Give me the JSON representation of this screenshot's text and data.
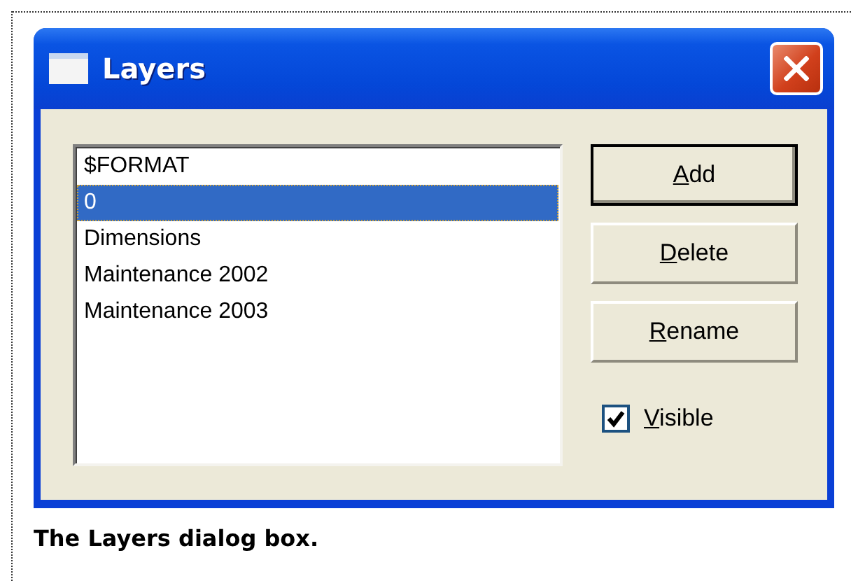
{
  "window": {
    "title": "Layers"
  },
  "list": {
    "items": [
      {
        "label": "$FORMAT",
        "selected": false
      },
      {
        "label": "0",
        "selected": true
      },
      {
        "label": "Dimensions",
        "selected": false
      },
      {
        "label": "Maintenance 2002",
        "selected": false
      },
      {
        "label": "Maintenance 2003",
        "selected": false
      }
    ]
  },
  "buttons": [
    {
      "label": "Add",
      "default": true,
      "underline_first": true
    },
    {
      "label": "Delete",
      "default": false,
      "underline_first": true
    },
    {
      "label": "Rename",
      "default": false,
      "underline_first": true
    }
  ],
  "checkbox": {
    "label": "Visible",
    "checked": true,
    "underline_first": true
  },
  "caption": "The Layers dialog box."
}
